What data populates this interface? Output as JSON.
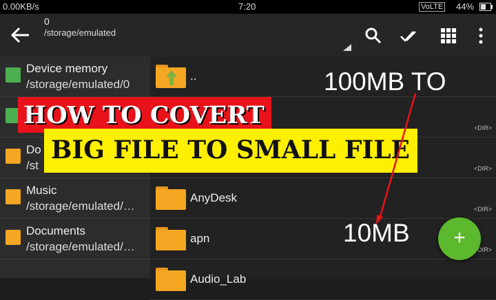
{
  "status_bar": {
    "speed": "0.00KB/s",
    "time": "7:20",
    "network": "VoLTE",
    "battery": "44%"
  },
  "app_bar": {
    "count": "0",
    "path": "/storage/emulated",
    "icons": [
      "back-arrow-icon",
      "search-icon",
      "select-all-icon",
      "grid-view-icon",
      "more-vert-icon"
    ]
  },
  "sidebar": {
    "items": [
      {
        "label": "Device memory",
        "path": "/storage/emulated/0",
        "icon": "device-memory-icon",
        "color": "#4caf50"
      },
      {
        "label": "Do",
        "path": "/st",
        "icon": "download-folder-icon",
        "color": "#f5a623"
      },
      {
        "label": "Music",
        "path": "/storage/emulated/…",
        "icon": "music-folder-icon",
        "color": "#f5a623"
      },
      {
        "label": "Documents",
        "path": "/storage/emulated/…",
        "icon": "documents-folder-icon",
        "color": "#f5a623"
      }
    ]
  },
  "files": [
    {
      "name": "..",
      "dir": ""
    },
    {
      "name": "",
      "dir": "<DIR>"
    },
    {
      "name": "",
      "dir": "<DIR>"
    },
    {
      "name": "AnyDesk",
      "dir": "<DIR>"
    },
    {
      "name": "apn",
      "dir": "<DIR>"
    },
    {
      "name": "Audio_Lab",
      "dir": ""
    }
  ],
  "overlay": {
    "headline_1": "HOW TO COVERT",
    "headline_2": "BIG FILE TO SMALL FILE",
    "from_size": "100MB TO",
    "to_size": "10MB"
  },
  "fab": {
    "label": "+",
    "color": "#5cb82c"
  },
  "colors": {
    "accent_red": "#e8121a",
    "accent_yellow": "#ffef00",
    "folder": "#f5a623"
  }
}
